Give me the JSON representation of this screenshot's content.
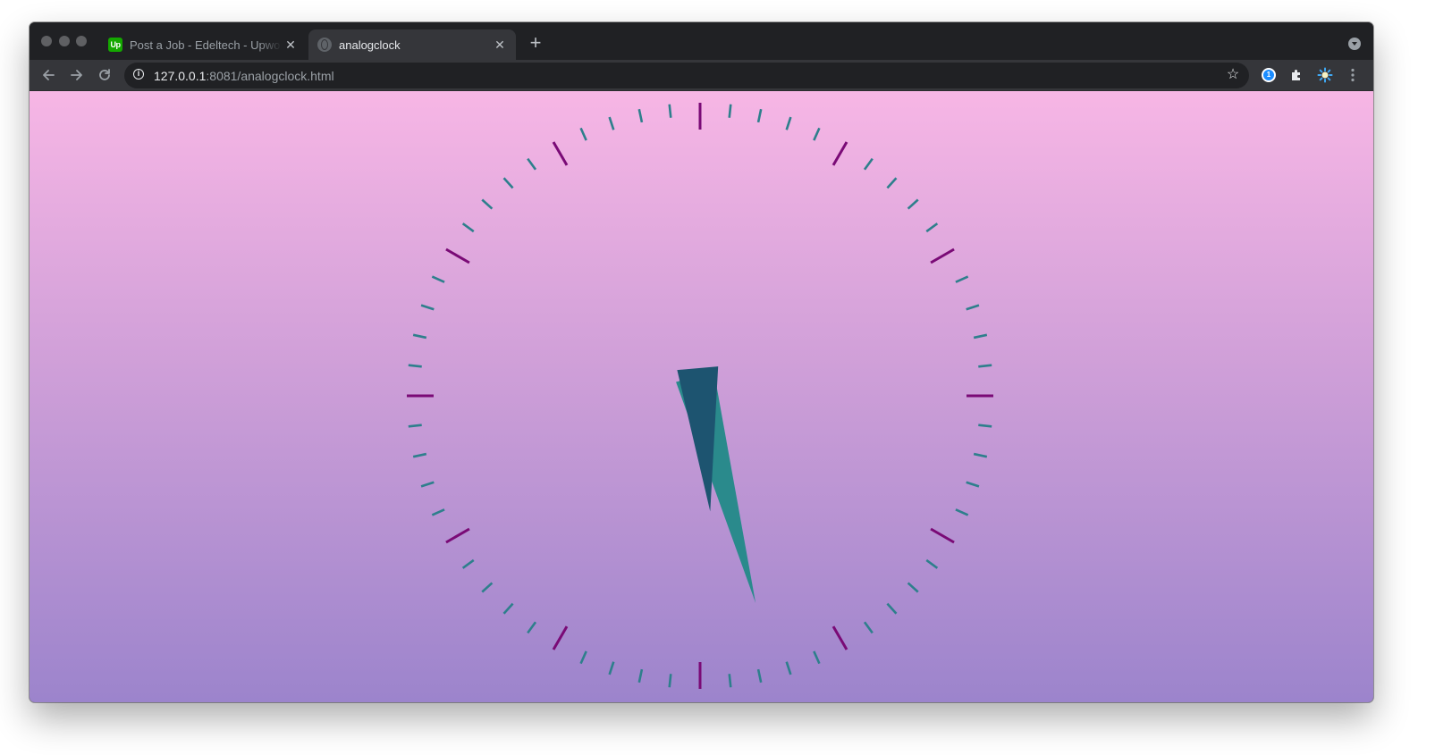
{
  "browser": {
    "tabs": [
      {
        "title": "Post a Job - Edeltech - Upwork",
        "favicon": "upwork-icon",
        "favicon_text": "Up",
        "active": false
      },
      {
        "title": "analogclock",
        "favicon": "globe-icon",
        "active": true
      }
    ],
    "close_glyph": "✕",
    "new_tab_glyph": "+",
    "address": {
      "host": "127.0.0.1",
      "rest": ":8081/analogclock.html"
    },
    "extensions": [
      "1password-icon",
      "puzzle-icon",
      "sun-extension-icon"
    ]
  },
  "clock": {
    "minute_tick_color": "#2e7f8c",
    "hour_tick_color": "#7a0a76",
    "hand_light_color": "#2a8a8c",
    "hand_dark_color": "#1d5470",
    "hour_hand_angle_deg": 175,
    "minute_hand_angle_deg": 165,
    "background_top": "#f7b6e5",
    "background_bottom": "#9c84cc"
  }
}
